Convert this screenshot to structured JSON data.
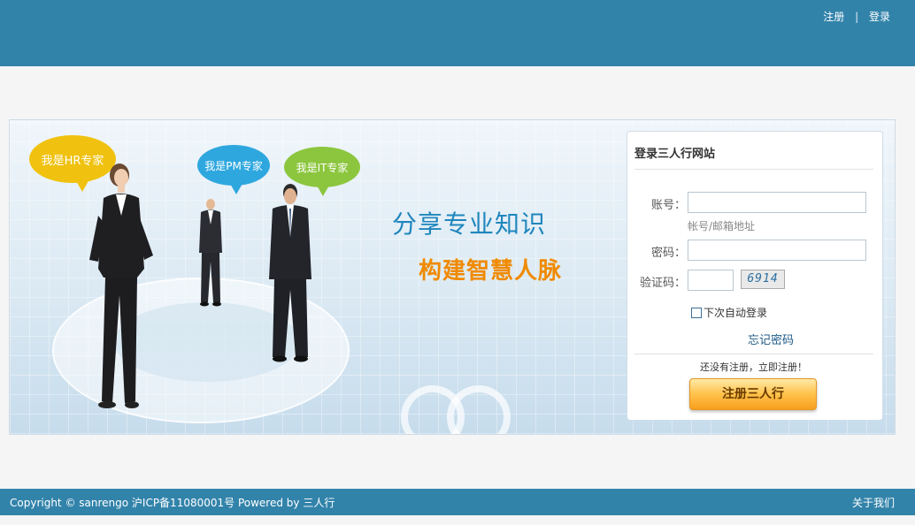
{
  "header": {
    "register_label": "注册",
    "separator": "|",
    "login_label": "登录"
  },
  "banner": {
    "bubble_hr": "我是HR专家",
    "bubble_pm": "我是PM专家",
    "bubble_it": "我是IT专家",
    "slogan_line1": "分享专业知识",
    "slogan_line2": "构建智慧人脉"
  },
  "login": {
    "title": "登录三人行网站",
    "account_label": "账号：",
    "account_hint": "帐号/邮箱地址",
    "password_label": "密码：",
    "captcha_label": "验证码：",
    "captcha_text": "6914",
    "remember_label": "下次自动登录",
    "forgot_label": "忘记密码",
    "no_account_text": "还没有注册，立即注册！",
    "register_button": "注册三人行"
  },
  "footer": {
    "copyright": "Copyright © sanrengo 沪ICP备11080001号 Powered by 三人行",
    "about_label": "关于我们"
  },
  "colors": {
    "brand_blue": "#3283aa",
    "accent_orange": "#f89f1d"
  }
}
